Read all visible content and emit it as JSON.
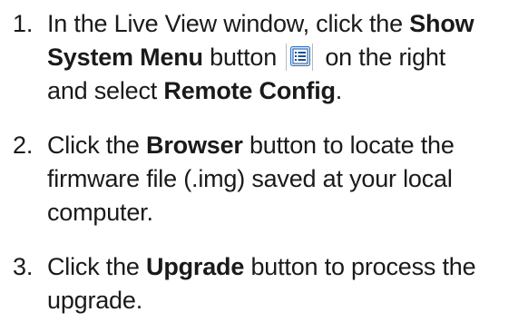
{
  "steps": [
    {
      "number": "1.",
      "line1": {
        "pre": "In the Live View window, click the ",
        "bold": "Show"
      },
      "line2": {
        "bold": "System Menu",
        "mid": " button",
        "post": " on the right"
      },
      "line3": {
        "pre": "and select ",
        "bold": "Remote Config",
        "post": "."
      },
      "icon": "show-system-menu-icon"
    },
    {
      "number": "2.",
      "line1": {
        "pre": "Click the ",
        "bold": "Browser",
        "post": " button to locate the"
      },
      "line2": "firmware file (.img) saved at your local",
      "line3": "computer."
    },
    {
      "number": "3.",
      "line1": {
        "pre": "Click the ",
        "bold": "Upgrade",
        "post": " button to process the"
      },
      "line2": "upgrade."
    }
  ],
  "colors": {
    "text": "#1a1a1a",
    "icon_frame": "#2f6fbf",
    "icon_fill": "#dde9f7",
    "separator": "#b9b9b9"
  }
}
